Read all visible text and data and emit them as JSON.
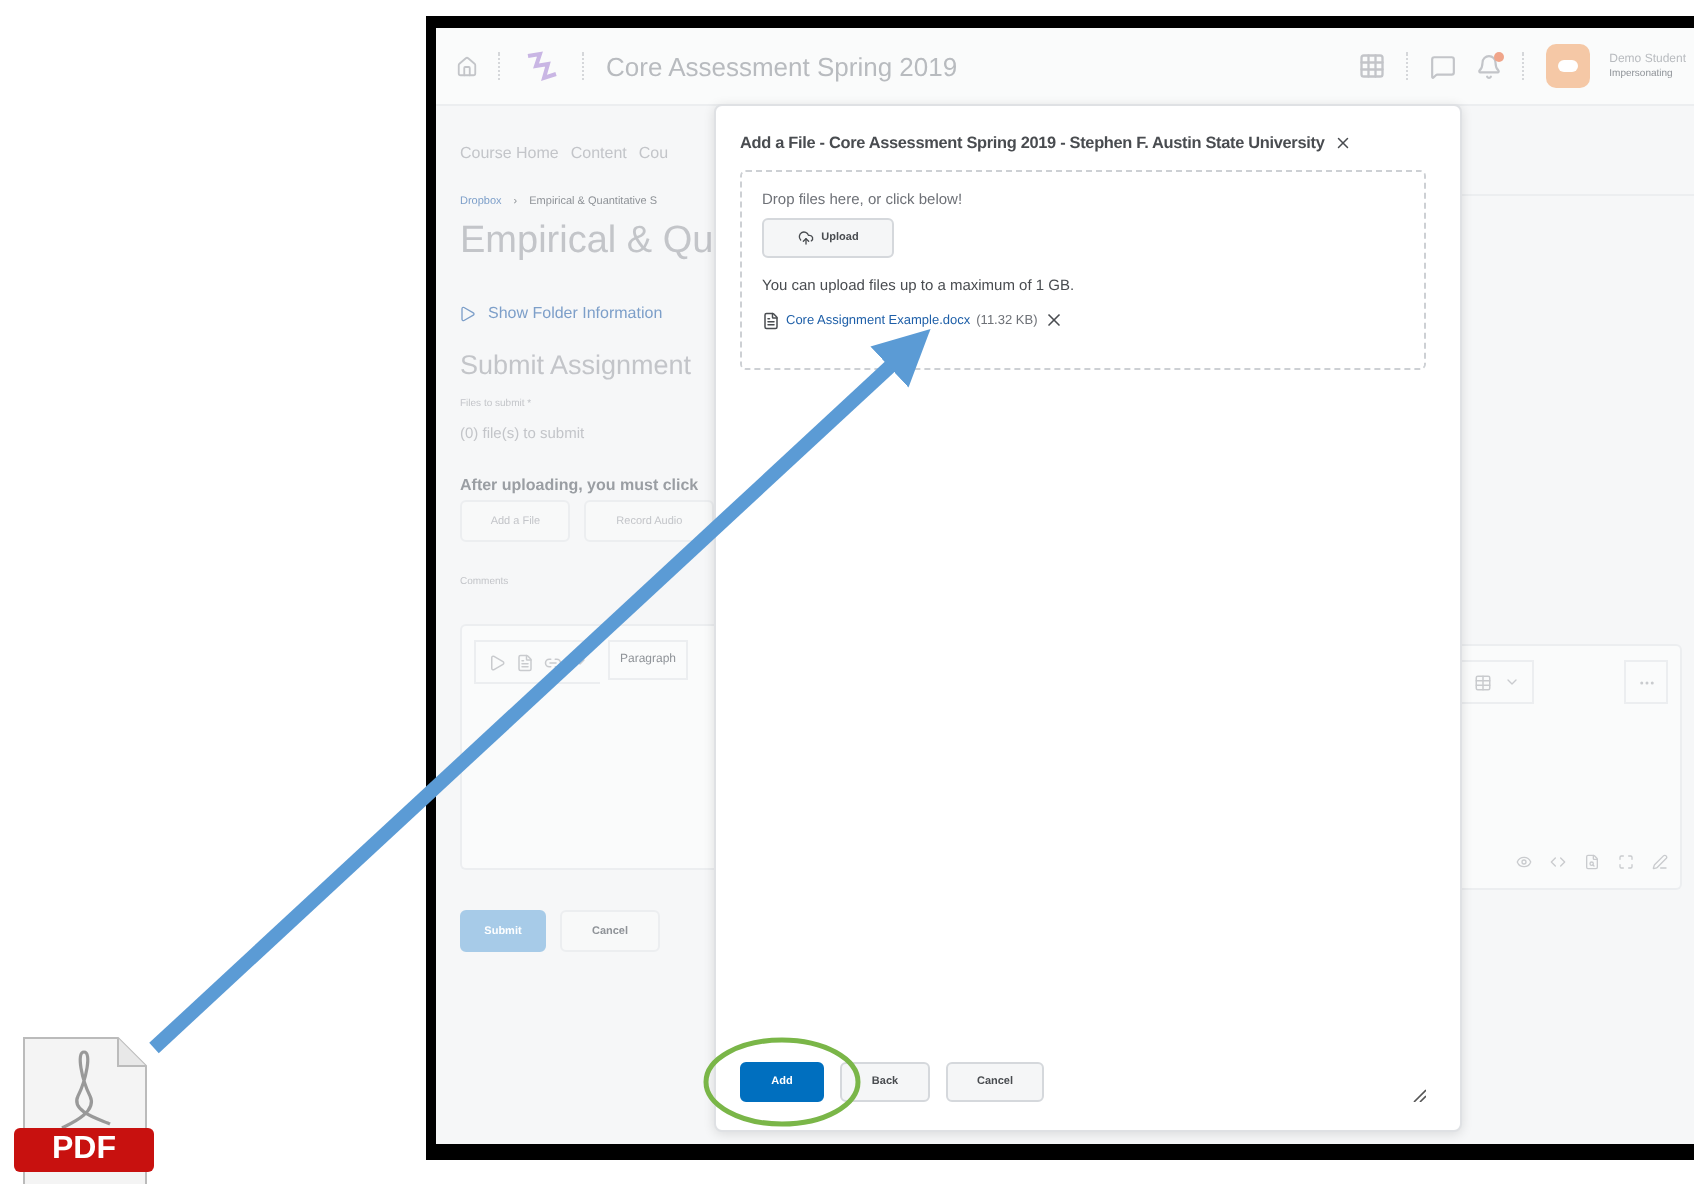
{
  "slide": {
    "file_icon": {
      "label": "PDF"
    }
  },
  "lms": {
    "top_bar": {
      "course_title": "Core Assessment Spring 2019",
      "notifications_unread": true,
      "user": {
        "name": "Demo Student",
        "role": "Impersonating"
      }
    },
    "nav": [
      "Course Home",
      "Content",
      "Cou"
    ],
    "breadcrumb": [
      "Dropbox",
      "Empirical & Quantitative S"
    ],
    "breadcrumb_separator": "›",
    "page_title": "Empirical & Qu",
    "folder_toggle": {
      "label": "Show Folder Information",
      "expanded": false
    },
    "section_title": "Submit Assignment",
    "files_label": "Files to submit *",
    "files_count": "(0) file(s) to submit",
    "instruction": "After uploading, you must click",
    "actions": [
      "Add a File",
      "Record Audio"
    ],
    "comments_label": "Comments",
    "editor": {
      "format": "Paragraph"
    },
    "form_buttons": [
      {
        "label": "Submit",
        "primary": true
      },
      {
        "label": "Cancel",
        "primary": false
      }
    ]
  },
  "dialog": {
    "title": "Add a File - Core Assessment Spring 2019 - Stephen F. Austin State University",
    "drop_hint": "Drop files here, or click below!",
    "upload_button": "Upload",
    "limit_note": "You can upload files up to a maximum of 1 GB.",
    "files": [
      {
        "name": "Core Assignment Example.docx",
        "size": "(11.32 KB)"
      }
    ],
    "buttons": [
      {
        "label": "Add",
        "primary": true,
        "highlighted": true
      },
      {
        "label": "Back",
        "primary": false,
        "highlighted": false
      },
      {
        "label": "Cancel",
        "primary": false,
        "highlighted": false
      }
    ]
  }
}
